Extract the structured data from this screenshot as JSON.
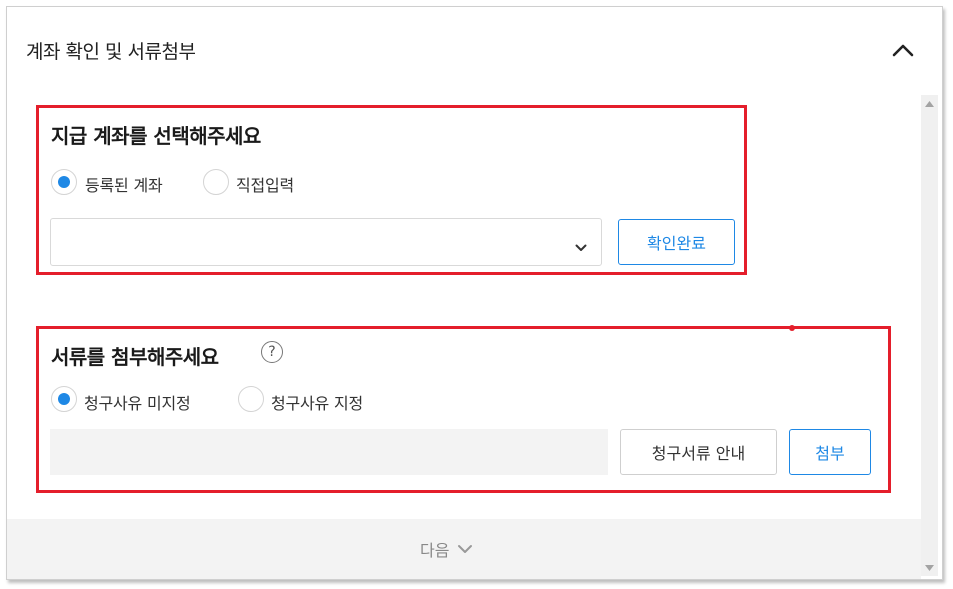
{
  "header": {
    "title": "계좌 확인 및 서류첨부"
  },
  "account_section": {
    "title": "지급 계좌를 선택해주세요",
    "radio_options": [
      {
        "label": "등록된 계좌",
        "checked": true
      },
      {
        "label": "직접입력",
        "checked": false
      }
    ],
    "select_value": "",
    "confirm_label": "확인완료"
  },
  "document_section": {
    "title": "서류를 첨부해주세요",
    "help_symbol": "?",
    "radio_options": [
      {
        "label": "청구사유 미지정",
        "checked": true
      },
      {
        "label": "청구사유 지정",
        "checked": false
      }
    ],
    "guide_label": "청구서류 안내",
    "attach_label": "첨부"
  },
  "footer": {
    "next_label": "다음"
  },
  "colors": {
    "accent": "#1e88e5",
    "highlight": "#e41e2b"
  },
  "icons": [
    "chevron-up-icon",
    "chevron-down-icon",
    "help-icon",
    "scroll-up-icon",
    "scroll-down-icon"
  ]
}
